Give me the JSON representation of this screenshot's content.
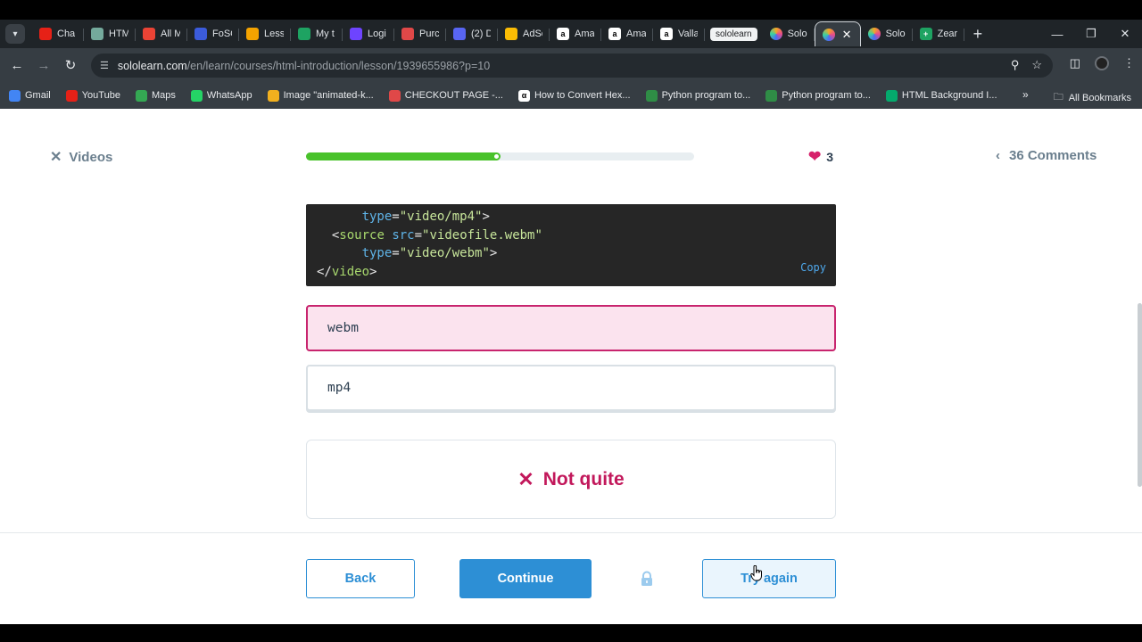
{
  "browser": {
    "tabs": [
      {
        "title": "Cha",
        "icon": "youtube-icon",
        "color": "#e62117"
      },
      {
        "title": "HTM",
        "icon": "chatgpt-icon",
        "color": "#74aa9c"
      },
      {
        "title": "All M",
        "icon": "gmail-icon",
        "color": "#ea4335"
      },
      {
        "title": "FoSC",
        "icon": "site-icon",
        "color": "#3b5bdb"
      },
      {
        "title": "Less",
        "icon": "pin-icon",
        "color": "#f4a300"
      },
      {
        "title": "My t",
        "icon": "sheets-icon",
        "color": "#1ea362"
      },
      {
        "title": "Logi",
        "icon": "upwork-icon",
        "color": "#6e44ff"
      },
      {
        "title": "Purc",
        "icon": "receipt-icon",
        "color": "#e04848"
      },
      {
        "title": "(2) D",
        "icon": "discord-icon",
        "color": "#5865f2"
      },
      {
        "title": "AdSe",
        "icon": "adsense-icon",
        "color": "#fbbc04"
      },
      {
        "title": "Ama",
        "icon": "amazon-icon",
        "color": "#ffffff"
      },
      {
        "title": "Ama",
        "icon": "amazon-icon",
        "color": "#ffffff"
      },
      {
        "title": "Valla",
        "icon": "amazon-icon",
        "color": "#ffffff"
      }
    ],
    "tooltip": "sololearn",
    "tab_solo_1": "Solo",
    "tab_solo_2": "Solo",
    "tab_zear": "Zear",
    "url_host": "sololearn.com",
    "url_path": "/en/learn/courses/html-introduction/lesson/1939655986?p=10",
    "bookmarks": [
      {
        "label": "Gmail",
        "icon": "gmail-icon",
        "color": "#4285f4"
      },
      {
        "label": "YouTube",
        "icon": "youtube-icon",
        "color": "#e62117"
      },
      {
        "label": "Maps",
        "icon": "maps-icon",
        "color": "#34a853"
      },
      {
        "label": "WhatsApp",
        "icon": "whatsapp-icon",
        "color": "#25d366"
      },
      {
        "label": "Image \"animated-k...",
        "icon": "star-icon",
        "color": "#f2b01e"
      },
      {
        "label": "CHECKOUT PAGE -...",
        "icon": "checkout-icon",
        "color": "#e04848"
      },
      {
        "label": "How to Convert Hex...",
        "icon": "alpha-icon",
        "color": "#000000"
      },
      {
        "label": "Python program to...",
        "icon": "gfg-icon",
        "color": "#2f8d46"
      },
      {
        "label": "Python program to...",
        "icon": "gfg-icon",
        "color": "#2f8d46"
      },
      {
        "label": "HTML Background I...",
        "icon": "w3-icon",
        "color": "#04aa6d"
      }
    ],
    "all_bookmarks": "All Bookmarks"
  },
  "lesson": {
    "videos_label": "Videos",
    "progress": 0.49,
    "hearts": "3",
    "comments_label": "36 Comments",
    "code_lines": [
      [
        {
          "t": "  ",
          "c": "punc"
        },
        {
          "t": "type",
          "c": "attr"
        },
        {
          "t": "=",
          "c": "punc"
        },
        {
          "t": "\"video/mp4\"",
          "c": "str"
        },
        {
          "t": ">",
          "c": "punc"
        }
      ],
      [
        {
          "t": "<",
          "c": "punc"
        },
        {
          "t": "source",
          "c": "tag"
        },
        {
          "t": " ",
          "c": "punc"
        },
        {
          "t": "src",
          "c": "attr"
        },
        {
          "t": "=",
          "c": "punc"
        },
        {
          "t": "\"videofile.webm\"",
          "c": "str"
        }
      ],
      [
        {
          "t": "  ",
          "c": "punc"
        },
        {
          "t": "type",
          "c": "attr"
        },
        {
          "t": "=",
          "c": "punc"
        },
        {
          "t": "\"video/webm\"",
          "c": "str"
        },
        {
          "t": ">",
          "c": "punc"
        }
      ],
      [
        {
          "t": "</",
          "c": "punc"
        },
        {
          "t": "video",
          "c": "tag"
        },
        {
          "t": ">",
          "c": "punc"
        }
      ]
    ],
    "copy_label": "Copy",
    "options": [
      "webm",
      "mp4"
    ],
    "feedback": "Not quite",
    "back_label": "Back",
    "continue_label": "Continue",
    "try_again_label": "Try again"
  },
  "colors": {
    "accent": "#2d8fd5",
    "progress": "#49c22b",
    "error": "#c2185b",
    "heart": "#d6216b"
  }
}
